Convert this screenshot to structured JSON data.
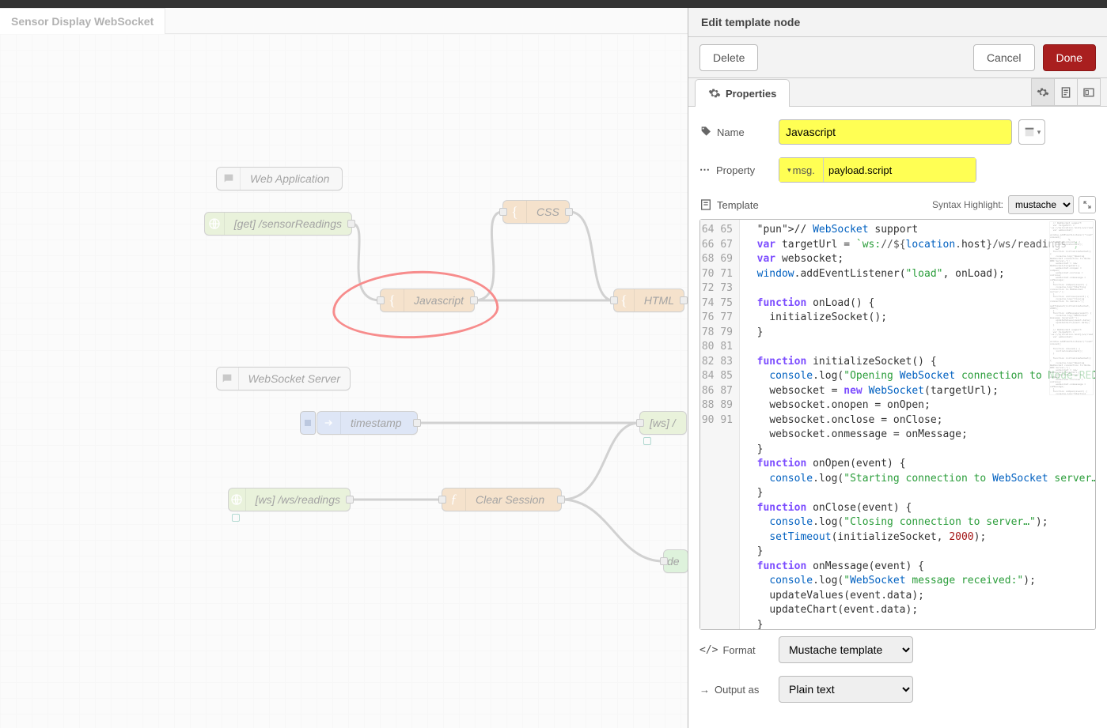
{
  "tab_title": "Sensor Display WebSocket",
  "panel": {
    "title": "Edit template node",
    "delete": "Delete",
    "cancel": "Cancel",
    "done": "Done",
    "properties_tab": "Properties"
  },
  "form": {
    "name_label": "Name",
    "name_value": "Javascript",
    "property_label": "Property",
    "property_type": "msg.",
    "property_value": "payload.script",
    "template_label": "Template",
    "syntax_label": "Syntax Highlight:",
    "syntax_value": "mustache",
    "format_label": "Format",
    "format_value": "Mustache template",
    "output_label": "Output as",
    "output_value": "Plain text"
  },
  "code": {
    "first_line": 64,
    "lines": [
      "  // WebSocket support",
      "  var targetUrl = `ws://${location.host}/ws/readings`;",
      "  var websocket;",
      "  window.addEventListener(\"load\", onLoad);",
      "",
      "  function onLoad() {",
      "    initializeSocket();",
      "  }",
      "",
      "  function initializeSocket() {",
      "    console.log(\"Opening WebSocket connection to Node-RED Server…\");",
      "    websocket = new WebSocket(targetUrl);",
      "    websocket.onopen = onOpen;",
      "    websocket.onclose = onClose;",
      "    websocket.onmessage = onMessage;",
      "  }",
      "  function onOpen(event) {",
      "    console.log(\"Starting connection to WebSocket server…\");",
      "  }",
      "  function onClose(event) {",
      "    console.log(\"Closing connection to server…\");",
      "    setTimeout(initializeSocket, 2000);",
      "  }",
      "  function onMessage(event) {",
      "    console.log(\"WebSocket message received:\");",
      "    updateValues(event.data);",
      "    updateChart(event.data);",
      "  }"
    ]
  },
  "nodes": {
    "webapp": "Web Application",
    "get": "[get] /sensorReadings",
    "css": "CSS",
    "js": "Javascript",
    "html": "HTML",
    "wsServer": "WebSocket Server",
    "timestamp": "timestamp",
    "wsOut": "[ws] /",
    "wsIn": "[ws] /ws/readings",
    "clear": "Clear Session",
    "debug": "de"
  }
}
